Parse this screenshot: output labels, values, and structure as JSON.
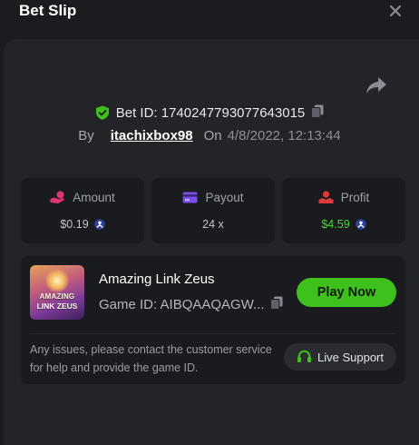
{
  "header": {
    "title": "Bet Slip"
  },
  "bet": {
    "id_text": "Bet ID: 1740247793077643015",
    "by_label": "By",
    "username": "itachixbox98",
    "on_label": "On",
    "datetime": "4/8/2022, 12:13:44"
  },
  "stats": {
    "amount": {
      "label": "Amount",
      "value": "$0.19"
    },
    "payout": {
      "label": "Payout",
      "value": "24 x"
    },
    "profit": {
      "label": "Profit",
      "value": "$4.59"
    }
  },
  "game": {
    "name": "Amazing Link Zeus",
    "id_text": "Game ID: AIBQAAQAGW...",
    "thumb_line1": "AMAZING",
    "thumb_line2": "LINK ZEUS",
    "play_label": "Play Now"
  },
  "help": {
    "text": "Any issues, please contact the customer service for help and provide the game ID.",
    "support_label": "Live Support"
  },
  "colors": {
    "accent_green": "#3ec11c",
    "profit_green": "#4fd23a",
    "amount_icon": "#e0366f",
    "payout_icon": "#7b4ee6",
    "profit_icon": "#e03a3a"
  },
  "icons": {
    "close": "close-icon",
    "share": "share-icon",
    "verified": "shield-check-icon",
    "copy": "copy-icon",
    "amount": "coin-hand-icon",
    "payout": "card-icon",
    "profit": "hand-coins-icon",
    "currency": "crypto-coin-icon",
    "support": "headset-icon"
  }
}
